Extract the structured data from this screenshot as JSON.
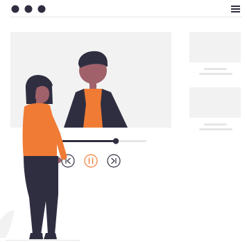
{
  "illustration": {
    "subject": "person-watching-video-player",
    "window_controls": [
      "dot",
      "dot",
      "dot"
    ],
    "menu_icon": "hamburger-menu-icon",
    "player_controls": [
      "rewind-icon",
      "pause-icon",
      "fast-forward-icon"
    ],
    "playback": {
      "progress": 0.66
    },
    "suggested_videos_count": 2
  },
  "colors": {
    "dark": "#2f2e41",
    "accent": "#f07b35",
    "panel": "#f2f2f2",
    "placeholder_line": "#e6e6e6",
    "track": "#e6e6e6",
    "skin": "#a0616a",
    "skin_dark": "#9e616a"
  }
}
